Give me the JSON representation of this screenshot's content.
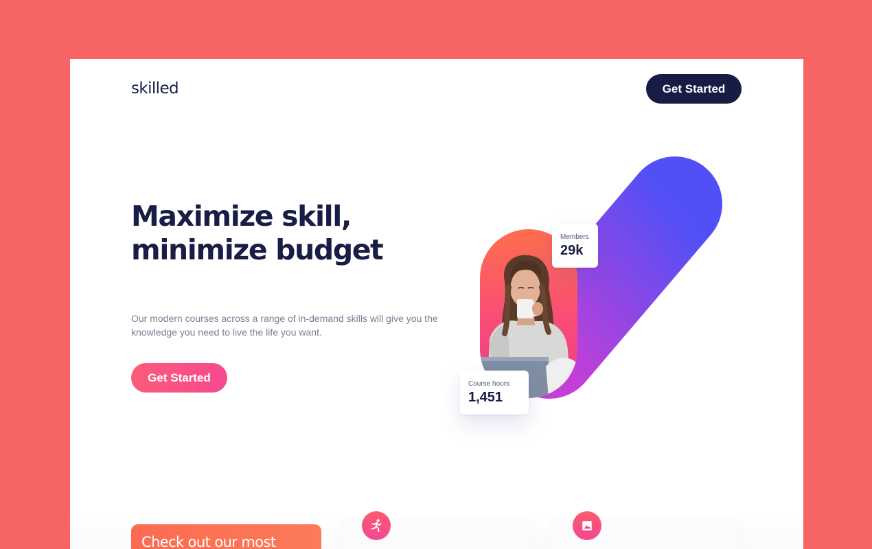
{
  "header": {
    "logo": "skilled",
    "cta_label": "Get Started"
  },
  "hero": {
    "headline_line1": "Maximize skill,",
    "headline_line2": "minimize budget",
    "subtitle": "Our modern courses across a range of in-demand skills will give you the knowledge you need to live the life you want.",
    "cta_label": "Get Started"
  },
  "stats": {
    "members_label": "Members",
    "members_value": "29k",
    "hours_label": "Course hours",
    "hours_value": "1,451"
  },
  "features": {
    "promo_text": "Check out our most",
    "icons": [
      "running-person-icon",
      "image-icon"
    ]
  },
  "colors": {
    "background": "#f76464",
    "navy": "#161c44",
    "pink": "#f7498f",
    "coral": "#fb6b52",
    "violet_start": "#c43fd6",
    "violet_end": "#5050f6"
  }
}
